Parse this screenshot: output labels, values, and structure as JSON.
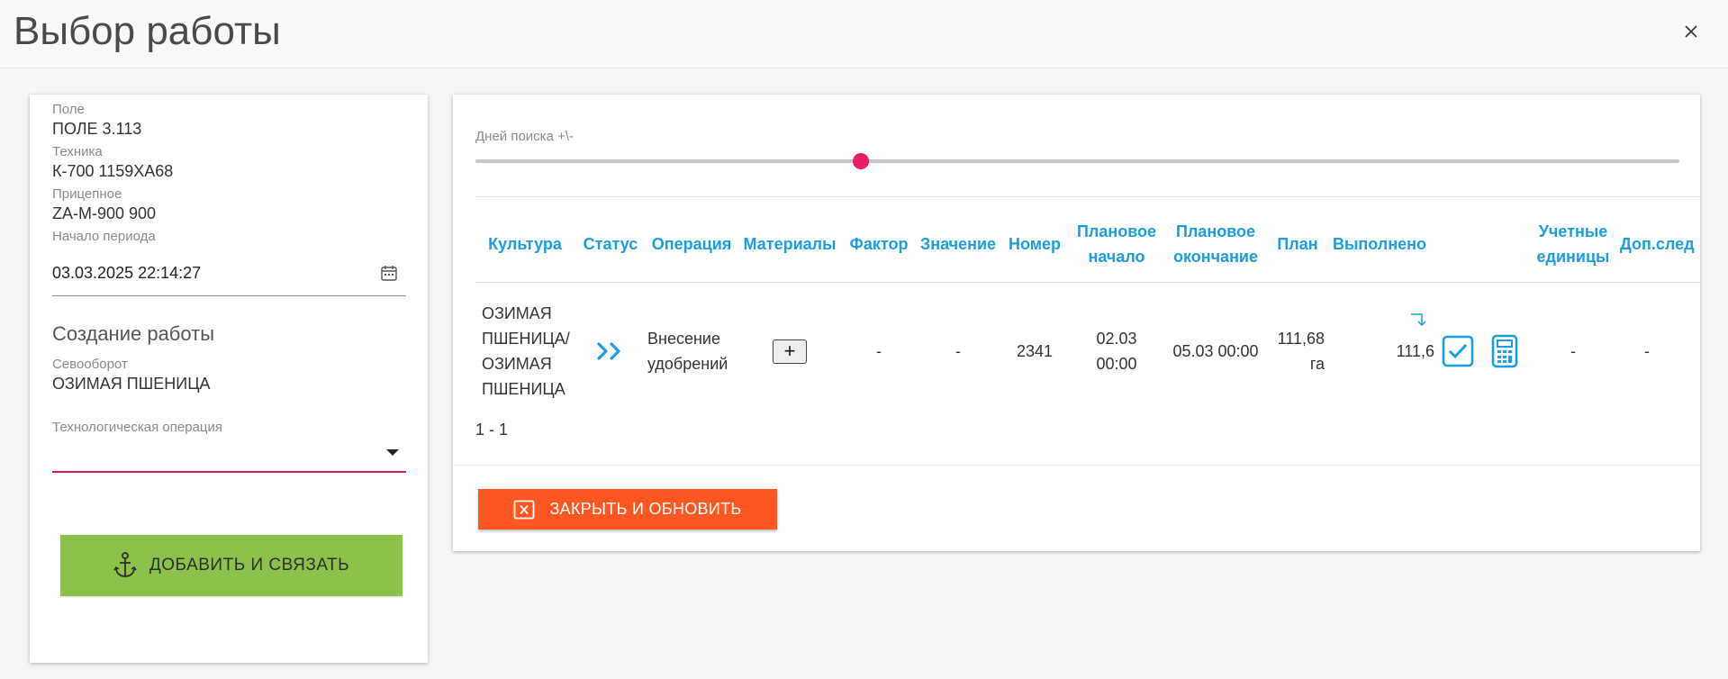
{
  "dialog": {
    "title": "Выбор работы"
  },
  "left": {
    "field": {
      "label": "Поле",
      "value": "ПОЛЕ 3.113"
    },
    "machine": {
      "label": "Техника",
      "value": "К-700 1159ХА68"
    },
    "trailer": {
      "label": "Прицепное",
      "value": "ZA-M-900 900"
    },
    "period_start": {
      "label": "Начало периода",
      "value": "03.03.2025 22:14:27"
    },
    "create_section": "Создание работы",
    "crop_rotation": {
      "label": "Севооборот",
      "value": "ОЗИМАЯ ПШЕНИЦА"
    },
    "tech_operation": {
      "label": "Технологическая операция",
      "value": ""
    },
    "add_button": "ДОБАВИТЬ И СВЯЗАТЬ"
  },
  "right": {
    "slider": {
      "label": "Дней поиска +\\-",
      "fraction": 0.32
    },
    "columns": {
      "culture": "Культура",
      "status": "Статус",
      "operation": "Операция",
      "materials": "Материалы",
      "factor": "Фактор",
      "value": "Значение",
      "number": "Номер",
      "plan_start_1": "Плановое",
      "plan_start_2": "начало",
      "plan_end_1": "Плановое",
      "plan_end_2": "окончание",
      "plan": "План",
      "done": "Выполнено",
      "units_1": "Учетные",
      "units_2": "единицы",
      "extra": "Доп.след"
    },
    "rows": [
      {
        "culture_l1": "ОЗИМАЯ",
        "culture_l2": "ПШЕНИЦА/",
        "culture_l3": "ОЗИМАЯ",
        "culture_l4": "ПШЕНИЦА",
        "operation_l1": "Внесение",
        "operation_l2": "удобрений",
        "materials_btn": "+",
        "factor": "-",
        "value": "-",
        "number": "2341",
        "plan_start_l1": "02.03",
        "plan_start_l2": "00:00",
        "plan_end": "05.03 00:00",
        "plan_l1": "111,68",
        "plan_l2": "га",
        "done": "111,6",
        "units": "-",
        "extra": "-"
      }
    ],
    "pager": "1 - 1",
    "close_button": "ЗАКРЫТЬ И ОБНОВИТЬ"
  },
  "colors": {
    "accent_blue": "#1a9ee0",
    "green": "#8bc34a",
    "orange": "#ff5722",
    "pink": "#e91e63"
  }
}
